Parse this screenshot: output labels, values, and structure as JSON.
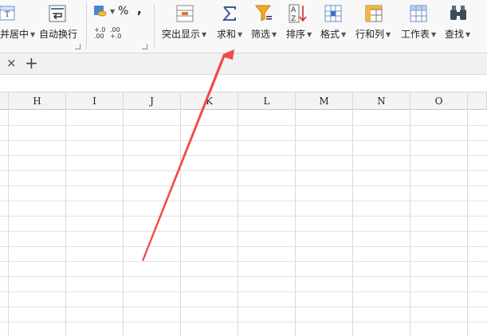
{
  "ribbon": {
    "merge_center_label": "并居中",
    "wrap_text_label": "自动换行",
    "percent_symbol": "%",
    "comma_symbol": ",",
    "inc_decimal_top": "+.0",
    "inc_decimal_bottom": ".00",
    "dec_decimal_top": ".00",
    "dec_decimal_bottom": "+.0",
    "highlight_label": "突出显示",
    "sum_label": "求和",
    "filter_label": "筛选",
    "sort_label": "排序",
    "format_label": "格式",
    "rowcol_label": "行和列",
    "worksheet_label": "工作表",
    "find_label": "查找"
  },
  "tabs": {
    "close_symbol": "×",
    "add_symbol": "+"
  },
  "columns": [
    "H",
    "I",
    "J",
    "K",
    "L",
    "M",
    "N",
    "O"
  ],
  "colors": {
    "annotation_arrow": "#f24a4a",
    "grid_line": "#d9d9d9",
    "header_bg": "#f3f3f3"
  }
}
